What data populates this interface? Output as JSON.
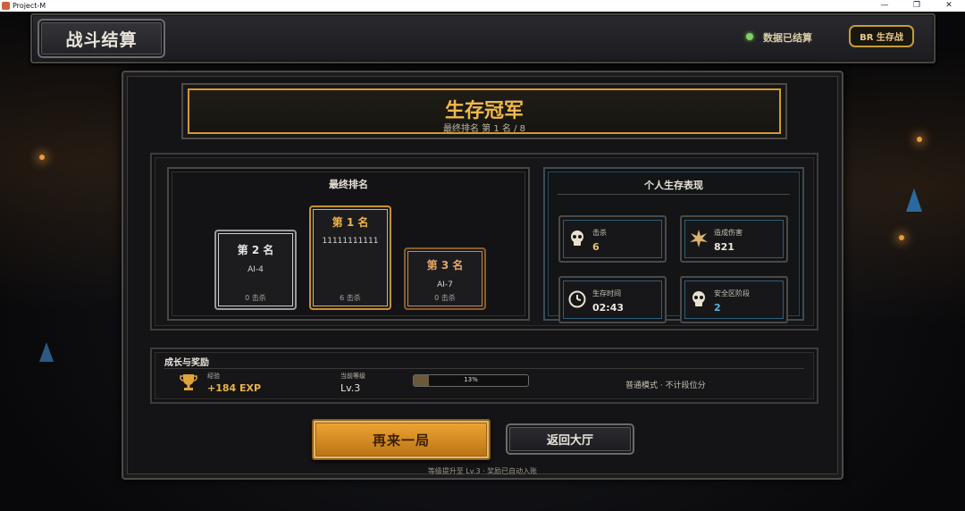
{
  "window": {
    "title": "Project-M",
    "controls": [
      "—",
      "❐",
      "✕"
    ]
  },
  "header": {
    "title": "战斗结算",
    "status_text": "数据已结算",
    "mode_badge": "BR 生存战"
  },
  "banner": {
    "title": "生存冠军",
    "subtitle": "最终排名 第 1 名 / 8"
  },
  "ranking": {
    "title": "最终排名",
    "podium": [
      {
        "place": "第 2 名",
        "player": "AI-4",
        "kills": "0 击杀"
      },
      {
        "place": "第 1 名",
        "player": "11111111111",
        "kills": "6 击杀"
      },
      {
        "place": "第 3 名",
        "player": "AI-7",
        "kills": "0 击杀"
      }
    ]
  },
  "performance": {
    "title": "个人生存表现",
    "stats": [
      {
        "label": "击杀",
        "value": "6",
        "icon": "skull-icon"
      },
      {
        "label": "造成伤害",
        "value": "821",
        "icon": "explosion-icon"
      },
      {
        "label": "生存时间",
        "value": "02:43",
        "icon": "clock-icon"
      },
      {
        "label": "安全区阶段",
        "value": "2",
        "icon": "skull-icon"
      }
    ]
  },
  "growth": {
    "title": "成长与奖励",
    "exp_label": "经验",
    "exp_value": "+184 EXP",
    "level_label": "当前等级",
    "level_value": "Lv.3",
    "progress_text": "13%",
    "progress": 0.13,
    "mode_note": "普通模式 · 不计段位分"
  },
  "actions": {
    "play_again": "再来一局",
    "back_lobby": "返回大厅"
  },
  "footer_note": "等级提升至 Lv.3 · 奖励已自动入账",
  "colors": {
    "accent_gold": "#f1b84a",
    "status_green": "#7ed35c",
    "stat_value_blue": "#4fb8e8"
  }
}
